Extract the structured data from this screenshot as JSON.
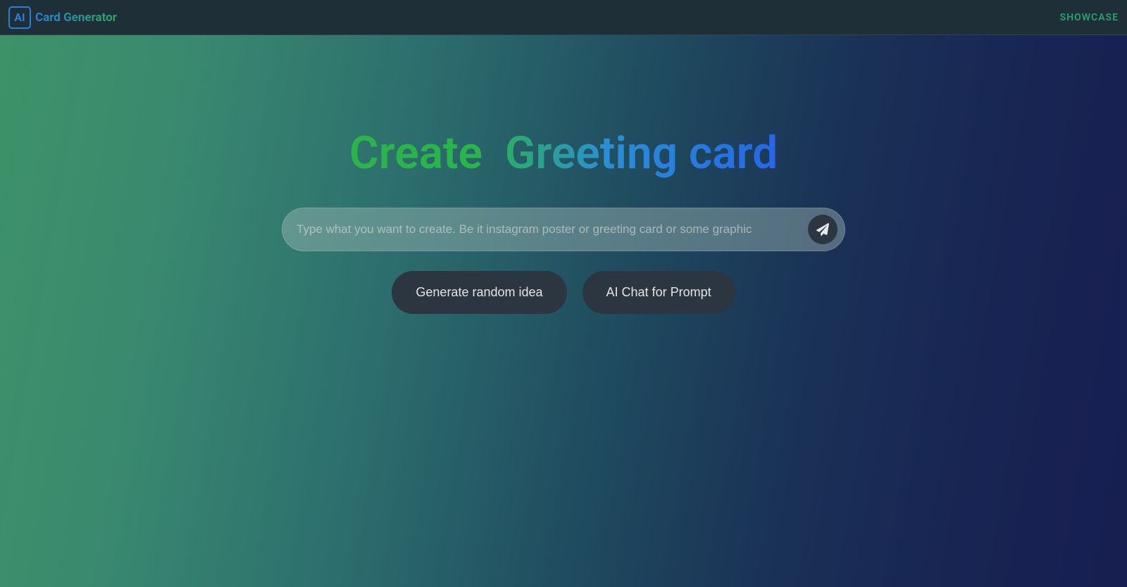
{
  "header": {
    "logo_badge": "AI",
    "logo_text": "Card Generator",
    "nav_showcase": "SHOWCASE"
  },
  "hero": {
    "title": "Create  Greeting card",
    "input_placeholder": "Type what you want to create. Be it instagram poster or greeting card or some graphic",
    "input_value": "",
    "btn_generate": "Generate random idea",
    "btn_chat": "AI Chat for Prompt"
  }
}
